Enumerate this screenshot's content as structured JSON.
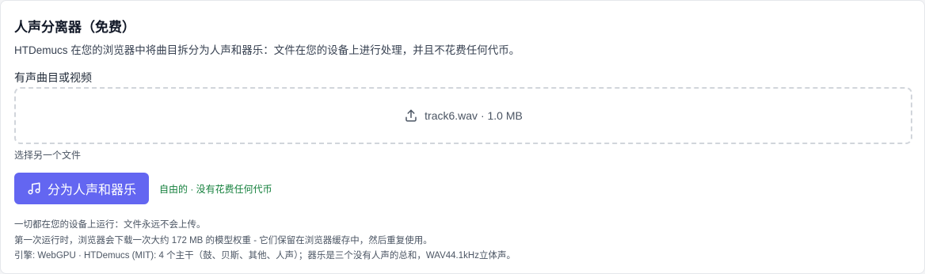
{
  "header": {
    "title": "人声分离器（免费）",
    "subtitle": "HTDemucs 在您的浏览器中将曲目拆分为人声和器乐：文件在您的设备上进行处理，并且不花费任何代币。"
  },
  "upload": {
    "label": "有声曲目或视频",
    "file_text": "track6.wav · 1.0 MB",
    "icon": "upload-icon",
    "choose_another": "选择另一个文件"
  },
  "action": {
    "button_label": "分为人声和器乐",
    "button_icon": "music-note-icon",
    "free_note": "自由的 · 没有花费任何代币",
    "accent_color": "#6366f1",
    "free_color": "#15803d"
  },
  "notes": [
    "一切都在您的设备上运行：文件永远不会上传。",
    "第一次运行时，浏览器会下载一次大约 172 MB 的模型权重 - 它们保留在浏览器缓存中，然后重复使用。",
    "引擎: WebGPU · HTDemucs (MIT): 4 个主干（鼓、贝斯、其他、人声）；器乐是三个没有人声的总和，WAV44.1kHz立体声。"
  ]
}
